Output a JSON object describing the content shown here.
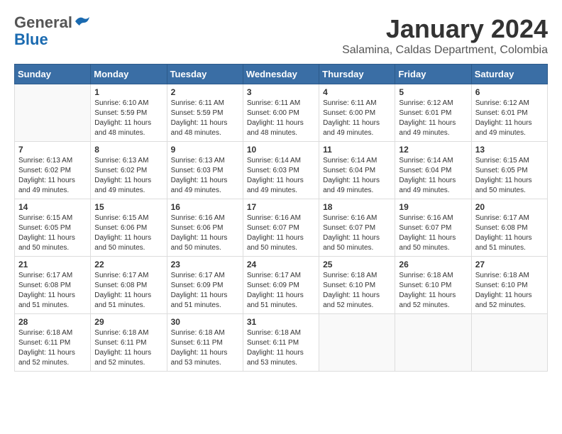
{
  "header": {
    "logo_general": "General",
    "logo_blue": "Blue",
    "title": "January 2024",
    "subtitle": "Salamina, Caldas Department, Colombia"
  },
  "weekdays": [
    "Sunday",
    "Monday",
    "Tuesday",
    "Wednesday",
    "Thursday",
    "Friday",
    "Saturday"
  ],
  "weeks": [
    [
      {
        "day": null
      },
      {
        "day": "1",
        "sunrise": "6:10 AM",
        "sunset": "5:59 PM",
        "daylight": "11 hours and 48 minutes."
      },
      {
        "day": "2",
        "sunrise": "6:11 AM",
        "sunset": "5:59 PM",
        "daylight": "11 hours and 48 minutes."
      },
      {
        "day": "3",
        "sunrise": "6:11 AM",
        "sunset": "6:00 PM",
        "daylight": "11 hours and 48 minutes."
      },
      {
        "day": "4",
        "sunrise": "6:11 AM",
        "sunset": "6:00 PM",
        "daylight": "11 hours and 49 minutes."
      },
      {
        "day": "5",
        "sunrise": "6:12 AM",
        "sunset": "6:01 PM",
        "daylight": "11 hours and 49 minutes."
      },
      {
        "day": "6",
        "sunrise": "6:12 AM",
        "sunset": "6:01 PM",
        "daylight": "11 hours and 49 minutes."
      }
    ],
    [
      {
        "day": "7",
        "sunrise": "6:13 AM",
        "sunset": "6:02 PM",
        "daylight": "11 hours and 49 minutes."
      },
      {
        "day": "8",
        "sunrise": "6:13 AM",
        "sunset": "6:02 PM",
        "daylight": "11 hours and 49 minutes."
      },
      {
        "day": "9",
        "sunrise": "6:13 AM",
        "sunset": "6:03 PM",
        "daylight": "11 hours and 49 minutes."
      },
      {
        "day": "10",
        "sunrise": "6:14 AM",
        "sunset": "6:03 PM",
        "daylight": "11 hours and 49 minutes."
      },
      {
        "day": "11",
        "sunrise": "6:14 AM",
        "sunset": "6:04 PM",
        "daylight": "11 hours and 49 minutes."
      },
      {
        "day": "12",
        "sunrise": "6:14 AM",
        "sunset": "6:04 PM",
        "daylight": "11 hours and 49 minutes."
      },
      {
        "day": "13",
        "sunrise": "6:15 AM",
        "sunset": "6:05 PM",
        "daylight": "11 hours and 50 minutes."
      }
    ],
    [
      {
        "day": "14",
        "sunrise": "6:15 AM",
        "sunset": "6:05 PM",
        "daylight": "11 hours and 50 minutes."
      },
      {
        "day": "15",
        "sunrise": "6:15 AM",
        "sunset": "6:06 PM",
        "daylight": "11 hours and 50 minutes."
      },
      {
        "day": "16",
        "sunrise": "6:16 AM",
        "sunset": "6:06 PM",
        "daylight": "11 hours and 50 minutes."
      },
      {
        "day": "17",
        "sunrise": "6:16 AM",
        "sunset": "6:07 PM",
        "daylight": "11 hours and 50 minutes."
      },
      {
        "day": "18",
        "sunrise": "6:16 AM",
        "sunset": "6:07 PM",
        "daylight": "11 hours and 50 minutes."
      },
      {
        "day": "19",
        "sunrise": "6:16 AM",
        "sunset": "6:07 PM",
        "daylight": "11 hours and 50 minutes."
      },
      {
        "day": "20",
        "sunrise": "6:17 AM",
        "sunset": "6:08 PM",
        "daylight": "11 hours and 51 minutes."
      }
    ],
    [
      {
        "day": "21",
        "sunrise": "6:17 AM",
        "sunset": "6:08 PM",
        "daylight": "11 hours and 51 minutes."
      },
      {
        "day": "22",
        "sunrise": "6:17 AM",
        "sunset": "6:08 PM",
        "daylight": "11 hours and 51 minutes."
      },
      {
        "day": "23",
        "sunrise": "6:17 AM",
        "sunset": "6:09 PM",
        "daylight": "11 hours and 51 minutes."
      },
      {
        "day": "24",
        "sunrise": "6:17 AM",
        "sunset": "6:09 PM",
        "daylight": "11 hours and 51 minutes."
      },
      {
        "day": "25",
        "sunrise": "6:18 AM",
        "sunset": "6:10 PM",
        "daylight": "11 hours and 52 minutes."
      },
      {
        "day": "26",
        "sunrise": "6:18 AM",
        "sunset": "6:10 PM",
        "daylight": "11 hours and 52 minutes."
      },
      {
        "day": "27",
        "sunrise": "6:18 AM",
        "sunset": "6:10 PM",
        "daylight": "11 hours and 52 minutes."
      }
    ],
    [
      {
        "day": "28",
        "sunrise": "6:18 AM",
        "sunset": "6:11 PM",
        "daylight": "11 hours and 52 minutes."
      },
      {
        "day": "29",
        "sunrise": "6:18 AM",
        "sunset": "6:11 PM",
        "daylight": "11 hours and 52 minutes."
      },
      {
        "day": "30",
        "sunrise": "6:18 AM",
        "sunset": "6:11 PM",
        "daylight": "11 hours and 53 minutes."
      },
      {
        "day": "31",
        "sunrise": "6:18 AM",
        "sunset": "6:11 PM",
        "daylight": "11 hours and 53 minutes."
      },
      {
        "day": null
      },
      {
        "day": null
      },
      {
        "day": null
      }
    ]
  ],
  "labels": {
    "sunrise": "Sunrise:",
    "sunset": "Sunset:",
    "daylight": "Daylight:"
  }
}
